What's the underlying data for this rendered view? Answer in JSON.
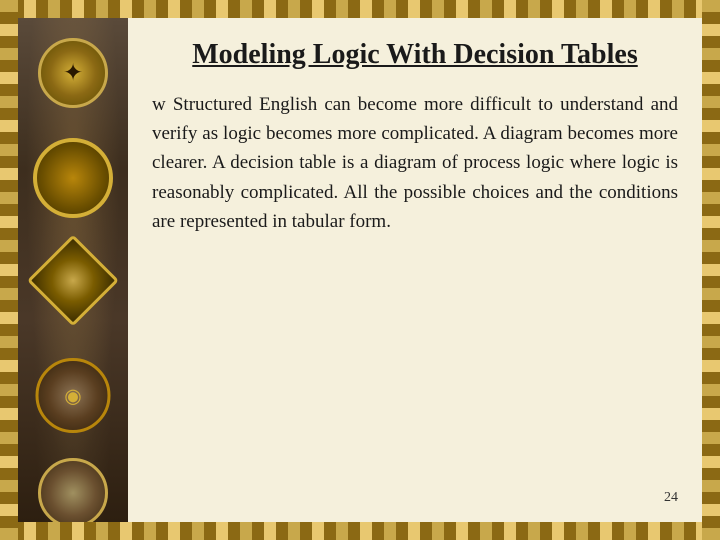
{
  "title": "Modeling Logic With Decision Tables",
  "content": {
    "bullet_marker": "w",
    "paragraph": "Structured English can become more difficult to understand and verify as logic becomes more complicated. A diagram becomes more clearer. A decision table is a diagram of process logic where logic is reasonably complicated. All the possible choices and the conditions are represented in tabular form.",
    "slide_number": "24"
  },
  "colors": {
    "background": "#8b7355",
    "content_bg": "#f5f0dc",
    "title_color": "#1a1a1a",
    "text_color": "#1a1a1a",
    "border_gold": "#c8a84b"
  }
}
